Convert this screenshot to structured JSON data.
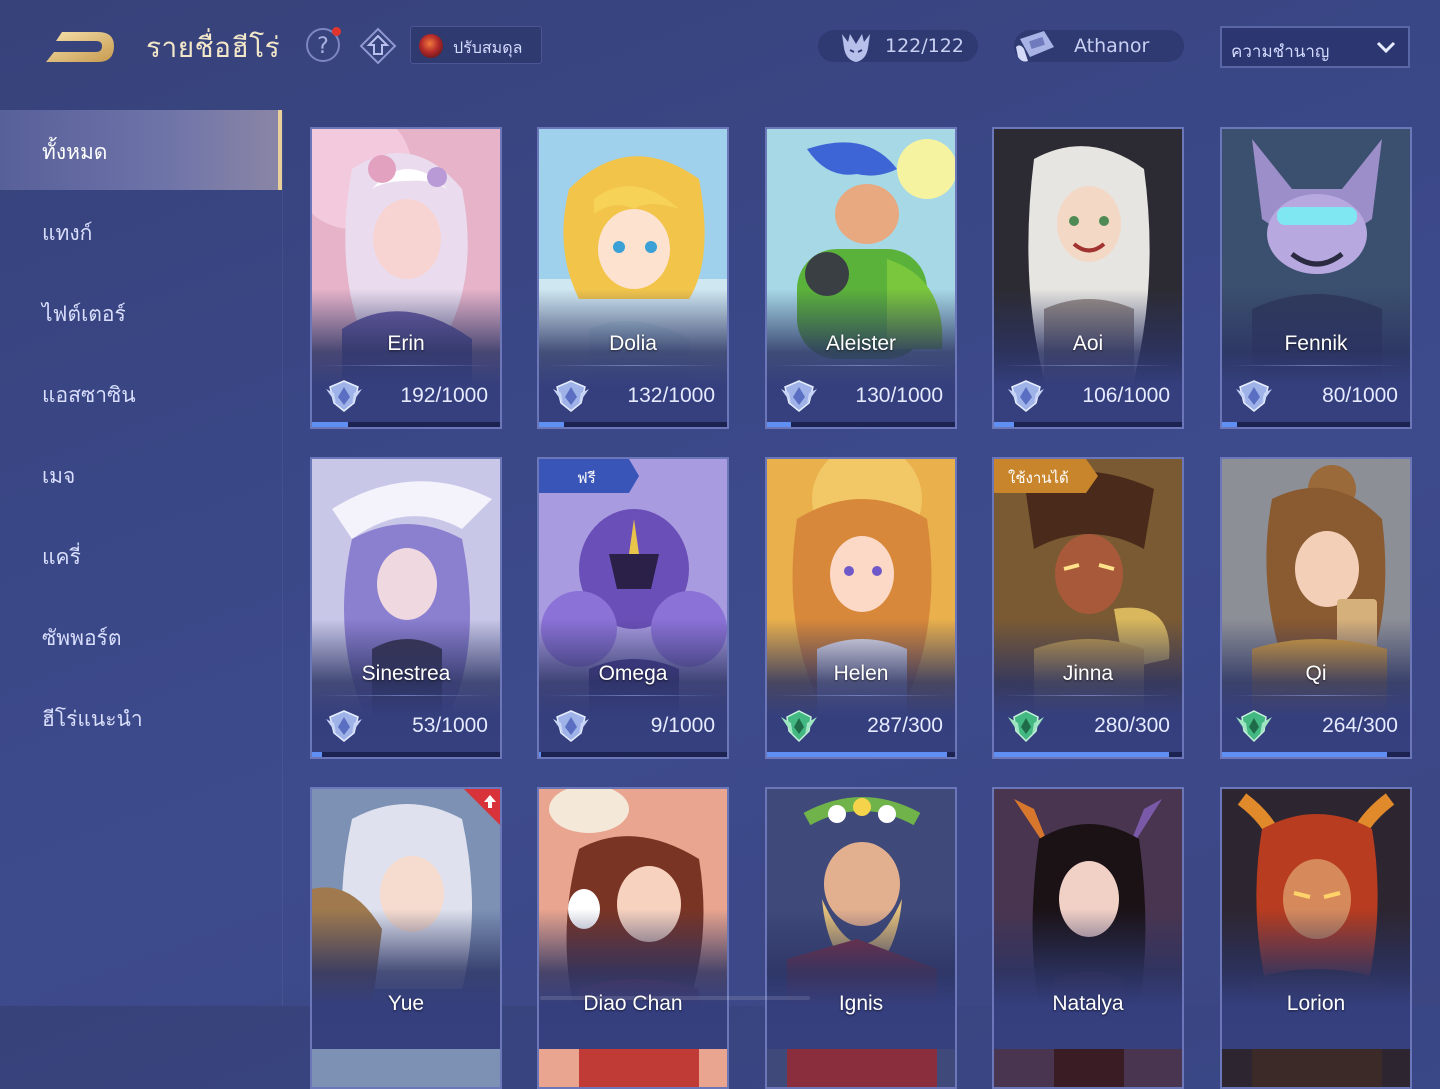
{
  "header": {
    "title": "รายชื่อฮีโร่",
    "balance_label": "ปรับสมดุล",
    "heroes_owned": "122/122",
    "player_name": "Athanor",
    "sort_value": "ความชำนาญ"
  },
  "sidebar": {
    "items": [
      {
        "label": "ทั้งหมด",
        "active": true
      },
      {
        "label": "แทงก์"
      },
      {
        "label": "ไฟต์เตอร์"
      },
      {
        "label": "แอสซาซิน"
      },
      {
        "label": "เมจ"
      },
      {
        "label": "แครี่"
      },
      {
        "label": "ซัพพอร์ต"
      },
      {
        "label": "ฮีโร่แนะนำ"
      }
    ]
  },
  "tags": {
    "free": "ฟรี",
    "usable": "ใช้งานได้"
  },
  "heroes": [
    {
      "name": "Erin",
      "mastery": "192/1000",
      "progress": 0.192,
      "rank": "silver"
    },
    {
      "name": "Dolia",
      "mastery": "132/1000",
      "progress": 0.132,
      "rank": "silver"
    },
    {
      "name": "Aleister",
      "mastery": "130/1000",
      "progress": 0.13,
      "rank": "silver"
    },
    {
      "name": "Aoi",
      "mastery": "106/1000",
      "progress": 0.106,
      "rank": "silver"
    },
    {
      "name": "Fennik",
      "mastery": "80/1000",
      "progress": 0.08,
      "rank": "silver"
    },
    {
      "name": "Sinestrea",
      "mastery": "53/1000",
      "progress": 0.053,
      "rank": "silver"
    },
    {
      "name": "Omega",
      "mastery": "9/1000",
      "progress": 0.009,
      "rank": "silver",
      "tag": "free"
    },
    {
      "name": "Helen",
      "mastery": "287/300",
      "progress": 0.957,
      "rank": "green"
    },
    {
      "name": "Jinna",
      "mastery": "280/300",
      "progress": 0.933,
      "rank": "green",
      "tag": "usable"
    },
    {
      "name": "Qi",
      "mastery": "264/300",
      "progress": 0.88,
      "rank": "green"
    },
    {
      "name": "Yue",
      "tag": "upgrade"
    },
    {
      "name": "Diao Chan"
    },
    {
      "name": "Ignis"
    },
    {
      "name": "Natalya"
    },
    {
      "name": "Lorion"
    }
  ],
  "colors": {
    "background": "#3a4684",
    "title_gold": "#f3e7c9",
    "progress_blue": "#5f8ff2",
    "active_bar": "#e9cf9a"
  }
}
